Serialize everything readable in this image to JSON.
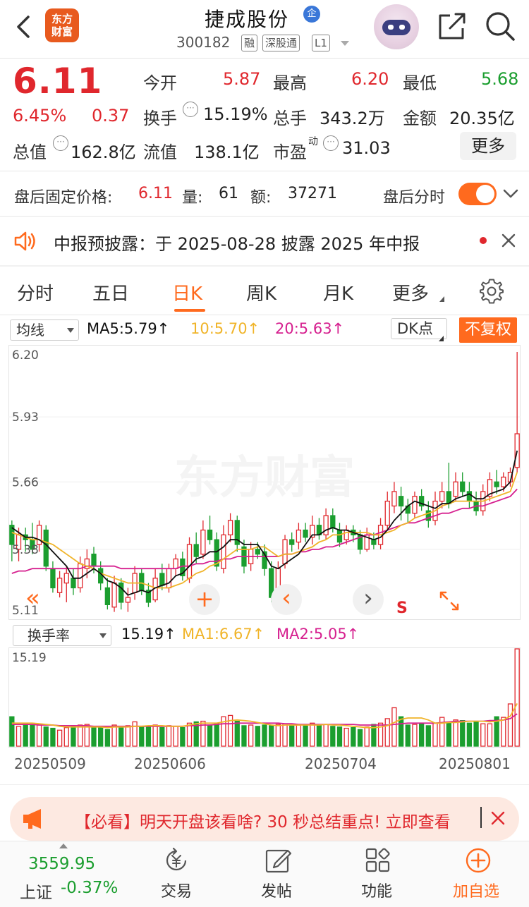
{
  "header": {
    "logo_line1": "东方",
    "logo_line2": "财富",
    "stock_name": "捷成股份",
    "ent_badge": "企",
    "stock_code": "300182",
    "tags": [
      "融",
      "深股通",
      "L1"
    ]
  },
  "quote": {
    "price": "6.11",
    "change_pct": "6.45%",
    "change": "0.37",
    "open_label": "今开",
    "open": "5.87",
    "high_label": "最高",
    "high": "6.20",
    "low_label": "最低",
    "low": "5.68",
    "turnover_label": "换手",
    "turnover": "15.19%",
    "volume_label": "总手",
    "volume": "343.2万",
    "amount_label": "金额",
    "amount": "20.35亿",
    "mktcap_label": "总值",
    "mktcap": "162.8亿",
    "float_label": "流值",
    "float_cap": "138.1亿",
    "pe_label": "市盈",
    "pe_sup": "动",
    "pe": "31.03",
    "more": "更多"
  },
  "after_hours": {
    "label": "盘后固定价格:",
    "price": "6.11",
    "vol_label": "量:",
    "vol": "61",
    "amt_label": "额:",
    "amt": "37271",
    "toggle_label": "盘后分时",
    "toggle_on": true
  },
  "notice": {
    "text": "中报预披露：于 2025-08-28 披露 2025 年中报"
  },
  "tabs": [
    "分时",
    "五日",
    "日K",
    "周K",
    "月K",
    "更多"
  ],
  "active_tab": "日K",
  "ma_legend": {
    "select": "均线",
    "ma5": "MA5:5.79↑",
    "ma10": "10:5.70↑",
    "ma20": "20:5.63↑",
    "dk": "DK点",
    "adjust": "不复权"
  },
  "kchart_axis": [
    "6.20",
    "5.93",
    "5.66",
    "5.38",
    "5.11"
  ],
  "kchart_controls": {
    "left": "«",
    "plus": "+",
    "prev": "‹",
    "next": "›",
    "s_mark": "S"
  },
  "volume_legend": {
    "select": "换手率",
    "value": "15.19↑",
    "ma1": "MA1:6.67↑",
    "ma2": "MA2:5.05↑"
  },
  "volume_axis_top": "15.19",
  "dates": [
    "20250509",
    "20250606",
    "20250704",
    "20250801"
  ],
  "watermark": "东方财富",
  "ad": {
    "text": "【必看】明天开盘该看啥? 30 秒总结重点! 立即查看"
  },
  "bottom_nav": {
    "index_value": "3559.95",
    "index_name": "上证",
    "index_change": "-0.37%",
    "trade": "交易",
    "post": "发帖",
    "func": "功能",
    "add": "加自选"
  },
  "colors": {
    "up": "#e0272d",
    "down": "#1b9e2f",
    "accent": "#ff6a1e",
    "ma5": "#111111",
    "ma10": "#f0b429",
    "ma20": "#d6208f"
  },
  "chart_data": {
    "type": "candlestick",
    "ylim": [
      5.11,
      6.2
    ],
    "candles": [
      [
        5.48,
        5.4,
        5.5,
        5.33
      ],
      [
        5.38,
        5.44,
        5.47,
        5.33
      ],
      [
        5.44,
        5.42,
        5.47,
        5.37
      ],
      [
        5.42,
        5.38,
        5.49,
        5.36
      ],
      [
        5.4,
        5.48,
        5.5,
        5.37
      ],
      [
        5.46,
        5.31,
        5.48,
        5.29
      ],
      [
        5.3,
        5.22,
        5.33,
        5.2
      ],
      [
        5.2,
        5.26,
        5.29,
        5.18
      ],
      [
        5.24,
        5.28,
        5.31,
        5.16
      ],
      [
        5.26,
        5.22,
        5.3,
        5.19
      ],
      [
        5.22,
        5.32,
        5.35,
        5.2
      ],
      [
        5.3,
        5.34,
        5.38,
        5.26
      ],
      [
        5.36,
        5.31,
        5.39,
        5.28
      ],
      [
        5.3,
        5.24,
        5.33,
        5.21
      ],
      [
        5.22,
        5.15,
        5.26,
        5.13
      ],
      [
        5.14,
        5.24,
        5.27,
        5.12
      ],
      [
        5.24,
        5.16,
        5.26,
        5.13
      ],
      [
        5.16,
        5.18,
        5.22,
        5.12
      ],
      [
        5.2,
        5.28,
        5.31,
        5.17
      ],
      [
        5.28,
        5.21,
        5.3,
        5.19
      ],
      [
        5.21,
        5.16,
        5.24,
        5.14
      ],
      [
        5.17,
        5.26,
        5.3,
        5.16
      ],
      [
        5.28,
        5.23,
        5.32,
        5.21
      ],
      [
        5.22,
        5.3,
        5.32,
        5.2
      ],
      [
        5.3,
        5.34,
        5.36,
        5.27
      ],
      [
        5.34,
        5.27,
        5.37,
        5.25
      ],
      [
        5.26,
        5.4,
        5.43,
        5.24
      ],
      [
        5.4,
        5.35,
        5.45,
        5.32
      ],
      [
        5.36,
        5.46,
        5.5,
        5.34
      ],
      [
        5.46,
        5.42,
        5.52,
        5.4
      ],
      [
        5.42,
        5.31,
        5.45,
        5.29
      ],
      [
        5.3,
        5.44,
        5.48,
        5.28
      ],
      [
        5.44,
        5.5,
        5.53,
        5.41
      ],
      [
        5.5,
        5.4,
        5.52,
        5.37
      ],
      [
        5.39,
        5.31,
        5.42,
        5.28
      ],
      [
        5.32,
        5.38,
        5.41,
        5.29
      ],
      [
        5.38,
        5.36,
        5.41,
        5.34
      ],
      [
        5.37,
        5.3,
        5.4,
        5.27
      ],
      [
        5.3,
        5.18,
        5.33,
        5.16
      ],
      [
        5.18,
        5.3,
        5.33,
        5.15
      ],
      [
        5.32,
        5.42,
        5.44,
        5.3
      ],
      [
        5.42,
        5.4,
        5.45,
        5.37
      ],
      [
        5.41,
        5.46,
        5.49,
        5.38
      ],
      [
        5.46,
        5.43,
        5.49,
        5.41
      ],
      [
        5.43,
        5.48,
        5.52,
        5.4
      ],
      [
        5.48,
        5.44,
        5.51,
        5.42
      ],
      [
        5.44,
        5.52,
        5.55,
        5.42
      ],
      [
        5.52,
        5.47,
        5.55,
        5.45
      ],
      [
        5.46,
        5.41,
        5.49,
        5.39
      ],
      [
        5.42,
        5.46,
        5.48,
        5.4
      ],
      [
        5.46,
        5.44,
        5.48,
        5.41
      ],
      [
        5.44,
        5.38,
        5.46,
        5.36
      ],
      [
        5.38,
        5.44,
        5.47,
        5.37
      ],
      [
        5.42,
        5.4,
        5.45,
        5.38
      ],
      [
        5.4,
        5.48,
        5.51,
        5.38
      ],
      [
        5.48,
        5.58,
        5.62,
        5.46
      ],
      [
        5.56,
        5.62,
        5.66,
        5.53
      ],
      [
        5.6,
        5.56,
        5.64,
        5.5
      ],
      [
        5.56,
        5.53,
        5.59,
        5.49
      ],
      [
        5.53,
        5.6,
        5.62,
        5.51
      ],
      [
        5.6,
        5.56,
        5.63,
        5.54
      ],
      [
        5.54,
        5.5,
        5.58,
        5.47
      ],
      [
        5.5,
        5.58,
        5.62,
        5.48
      ],
      [
        5.58,
        5.62,
        5.66,
        5.55
      ],
      [
        5.62,
        5.57,
        5.74,
        5.55
      ],
      [
        5.6,
        5.66,
        5.7,
        5.58
      ],
      [
        5.66,
        5.62,
        5.7,
        5.6
      ],
      [
        5.62,
        5.58,
        5.66,
        5.55
      ],
      [
        5.58,
        5.54,
        5.62,
        5.52
      ],
      [
        5.54,
        5.62,
        5.65,
        5.52
      ],
      [
        5.6,
        5.67,
        5.7,
        5.58
      ],
      [
        5.66,
        5.64,
        5.71,
        5.61
      ],
      [
        5.64,
        5.68,
        5.7,
        5.62
      ],
      [
        5.66,
        5.7,
        5.72,
        5.64
      ],
      [
        5.72,
        5.86,
        6.2,
        5.7
      ]
    ],
    "ma5": [
      5.47,
      5.45,
      5.43,
      5.43,
      5.42,
      5.4,
      5.37,
      5.34,
      5.31,
      5.26,
      5.26,
      5.28,
      5.3,
      5.28,
      5.25,
      5.24,
      5.22,
      5.19,
      5.2,
      5.21,
      5.2,
      5.22,
      5.23,
      5.24,
      5.27,
      5.28,
      5.31,
      5.34,
      5.35,
      5.37,
      5.37,
      5.39,
      5.42,
      5.42,
      5.4,
      5.4,
      5.4,
      5.36,
      5.31,
      5.3,
      5.32,
      5.34,
      5.36,
      5.4,
      5.44,
      5.44,
      5.46,
      5.47,
      5.46,
      5.46,
      5.45,
      5.44,
      5.43,
      5.42,
      5.43,
      5.46,
      5.5,
      5.53,
      5.56,
      5.58,
      5.57,
      5.56,
      5.55,
      5.57,
      5.57,
      5.59,
      5.6,
      5.61,
      5.59,
      5.59,
      5.61,
      5.62,
      5.63,
      5.66,
      5.79
    ],
    "ma10": [
      5.45,
      5.44,
      5.43,
      5.42,
      5.42,
      5.41,
      5.4,
      5.38,
      5.36,
      5.34,
      5.32,
      5.31,
      5.3,
      5.28,
      5.27,
      5.26,
      5.25,
      5.24,
      5.24,
      5.24,
      5.23,
      5.22,
      5.22,
      5.22,
      5.23,
      5.24,
      5.26,
      5.28,
      5.29,
      5.31,
      5.32,
      5.34,
      5.36,
      5.38,
      5.38,
      5.38,
      5.39,
      5.39,
      5.37,
      5.35,
      5.36,
      5.36,
      5.37,
      5.38,
      5.39,
      5.41,
      5.42,
      5.44,
      5.44,
      5.45,
      5.45,
      5.45,
      5.45,
      5.44,
      5.44,
      5.45,
      5.46,
      5.48,
      5.49,
      5.51,
      5.52,
      5.53,
      5.54,
      5.56,
      5.57,
      5.58,
      5.58,
      5.58,
      5.58,
      5.58,
      5.59,
      5.6,
      5.61,
      5.62,
      5.7
    ],
    "ma20": [
      5.28,
      5.29,
      5.29,
      5.3,
      5.3,
      5.3,
      5.3,
      5.3,
      5.3,
      5.3,
      5.3,
      5.31,
      5.31,
      5.31,
      5.31,
      5.31,
      5.3,
      5.3,
      5.3,
      5.3,
      5.3,
      5.3,
      5.3,
      5.3,
      5.3,
      5.31,
      5.31,
      5.32,
      5.32,
      5.33,
      5.33,
      5.34,
      5.34,
      5.35,
      5.35,
      5.35,
      5.35,
      5.35,
      5.35,
      5.35,
      5.36,
      5.36,
      5.37,
      5.37,
      5.38,
      5.38,
      5.39,
      5.39,
      5.4,
      5.41,
      5.42,
      5.43,
      5.44,
      5.44,
      5.45,
      5.46,
      5.47,
      5.48,
      5.49,
      5.49,
      5.5,
      5.51,
      5.52,
      5.53,
      5.53,
      5.54,
      5.55,
      5.55,
      5.56,
      5.56,
      5.57,
      5.58,
      5.59,
      5.6,
      5.63
    ],
    "turnover": [
      4.6,
      3.1,
      3.6,
      3.4,
      3.3,
      3.0,
      2.8,
      2.5,
      2.9,
      3.1,
      3.3,
      3.4,
      3.0,
      2.9,
      2.6,
      3.3,
      3.0,
      3.2,
      3.8,
      3.1,
      3.0,
      3.3,
      2.9,
      3.2,
      3.1,
      2.9,
      3.6,
      3.8,
      3.9,
      3.3,
      3.6,
      4.6,
      4.8,
      3.9,
      3.2,
      3.3,
      3.1,
      3.3,
      3.2,
      3.4,
      3.5,
      3.3,
      3.3,
      3.2,
      3.6,
      3.3,
      3.4,
      3.1,
      3.0,
      2.8,
      2.9,
      2.6,
      3.0,
      3.4,
      3.6,
      4.3,
      6.0,
      4.6,
      3.3,
      3.4,
      3.5,
      3.2,
      3.6,
      4.5,
      3.7,
      4.1,
      4.0,
      3.6,
      3.8,
      3.5,
      3.5,
      4.6,
      4.5,
      6.6,
      15.19
    ],
    "turnover_ma1": [
      3.6,
      3.6,
      3.6,
      3.6,
      3.5,
      3.4,
      3.3,
      3.1,
      3.0,
      3.0,
      3.0,
      3.0,
      3.0,
      3.0,
      2.9,
      3.0,
      3.0,
      3.0,
      3.1,
      3.1,
      3.2,
      3.2,
      3.2,
      3.1,
      3.1,
      3.1,
      3.3,
      3.5,
      3.6,
      3.6,
      3.6,
      3.8,
      4.0,
      4.1,
      4.0,
      3.9,
      3.7,
      3.5,
      3.3,
      3.2,
      3.3,
      3.3,
      3.3,
      3.3,
      3.3,
      3.3,
      3.4,
      3.3,
      3.3,
      3.2,
      3.1,
      3.0,
      2.9,
      2.9,
      3.0,
      3.2,
      3.7,
      4.2,
      4.4,
      4.4,
      4.4,
      4.1,
      3.6,
      3.6,
      3.7,
      3.7,
      3.8,
      3.9,
      3.9,
      3.9,
      3.8,
      3.9,
      4.1,
      4.7,
      6.67
    ],
    "turnover_ma2": [
      3.4,
      3.4,
      3.4,
      3.4,
      3.3,
      3.3,
      3.3,
      3.2,
      3.2,
      3.2,
      3.2,
      3.2,
      3.1,
      3.1,
      3.1,
      3.1,
      3.1,
      3.1,
      3.1,
      3.1,
      3.1,
      3.1,
      3.1,
      3.1,
      3.1,
      3.1,
      3.2,
      3.2,
      3.3,
      3.3,
      3.4,
      3.5,
      3.5,
      3.6,
      3.6,
      3.6,
      3.6,
      3.6,
      3.6,
      3.6,
      3.5,
      3.5,
      3.4,
      3.4,
      3.4,
      3.4,
      3.4,
      3.4,
      3.4,
      3.4,
      3.4,
      3.3,
      3.3,
      3.3,
      3.3,
      3.3,
      3.4,
      3.5,
      3.6,
      3.6,
      3.6,
      3.6,
      3.6,
      3.7,
      3.8,
      3.9,
      3.9,
      3.9,
      3.9,
      3.9,
      4.0,
      4.0,
      4.1,
      4.3,
      5.05
    ]
  }
}
